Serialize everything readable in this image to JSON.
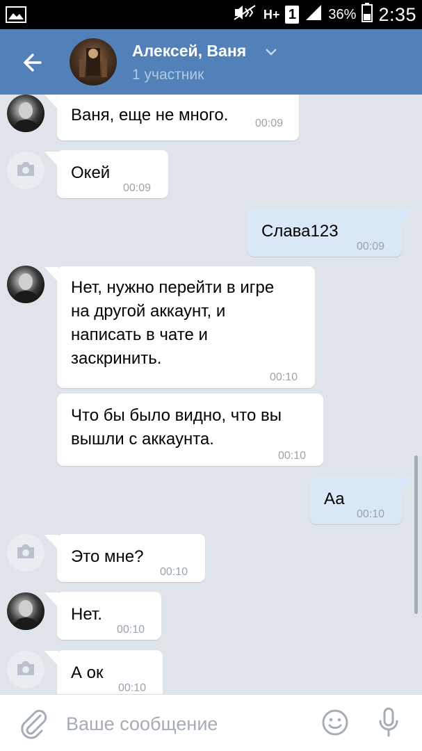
{
  "status_bar": {
    "network": "H+",
    "sim": "1",
    "battery": "36%",
    "time": "2:35"
  },
  "header": {
    "title": "Алексей, Ваня",
    "subtitle": "1 участник"
  },
  "messages": [
    {
      "dir": "in",
      "text": "Ваня, еще не много.",
      "time": "00:09"
    },
    {
      "dir": "in",
      "text": "Окей",
      "time": "00:09"
    },
    {
      "dir": "out",
      "text": "Слава123",
      "time": "00:09"
    },
    {
      "dir": "in",
      "text_lines": [
        "Нет, нужно перейти в игре",
        "на другой аккаунт, и",
        "написать в чате и",
        "заскринить."
      ],
      "time": "00:10"
    },
    {
      "dir": "in",
      "text_lines": [
        "Что бы было видно, что вы",
        "вышли с аккаунта."
      ],
      "time": "00:10"
    },
    {
      "dir": "out",
      "text": "Аа",
      "time": "00:10"
    },
    {
      "dir": "in",
      "text": "Это мне?",
      "time": "00:10"
    },
    {
      "dir": "in",
      "text": "Нет.",
      "time": "00:10"
    },
    {
      "dir": "in",
      "text": "А ок",
      "time": "00:10"
    }
  ],
  "input": {
    "placeholder": "Ваше сообщение"
  },
  "colors": {
    "header": "#5181b8",
    "chat_bg": "#dfe4ea",
    "incoming": "#ffffff",
    "outgoing": "#dae7f6"
  }
}
